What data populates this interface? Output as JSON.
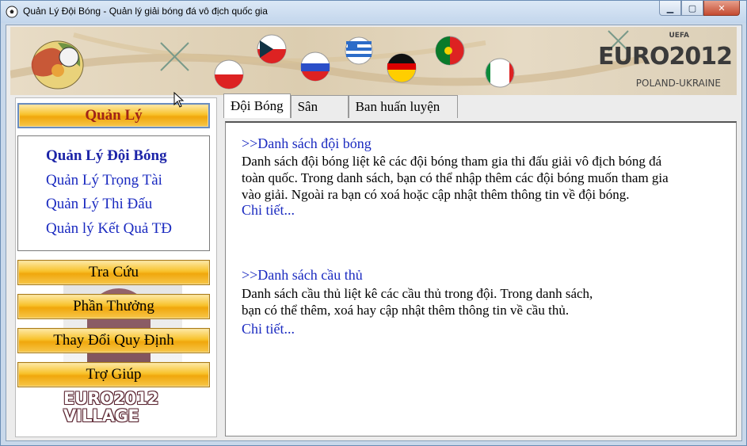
{
  "window": {
    "title": "Quản Lý Đội Bóng - Quản lý giải bóng đá vô địch quốc gia",
    "controls": [
      "minimize",
      "maximize",
      "close"
    ]
  },
  "banner": {
    "uefa": "UEFA",
    "logo_text": "EURO2012",
    "subtitle": "POLAND-UKRAINE",
    "flags": [
      "Poland",
      "Czech Republic",
      "Russia",
      "Greece",
      "Germany",
      "Portugal",
      "Italy"
    ]
  },
  "sidebar": {
    "main_button": "Quản Lý",
    "nav_items": [
      "Quản Lý Đội Bóng",
      "Quản Lý Trọng Tài",
      "Quản Lý Thi Đấu",
      "Quản lý Kết Quả TĐ"
    ],
    "buttons": [
      "Tra Cứu",
      "Phần Thưởng",
      "Thay Đổi Quy Định",
      "Trợ Giúp"
    ],
    "village_line1": "EURO2012",
    "village_line2": "VILLAGE"
  },
  "tabs": [
    "Đội Bóng",
    "Sân",
    "Ban huấn luyện"
  ],
  "content": {
    "section1": {
      "title": ">>Danh sách đội bóng",
      "lines": [
        "Danh sách đội bóng liệt kê các đội bóng tham gia thi đấu giải vô địch bóng đá",
        "toàn quốc. Trong danh sách, bạn có thể nhập thêm các đội bóng muốn tham gia",
        "vào giải. Ngoài ra bạn có xoá hoặc cập nhật thêm thông tin về đội bóng."
      ],
      "link": "Chi tiết..."
    },
    "section2": {
      "title": ">>Danh sách cầu thủ",
      "lines": [
        "Danh sách cầu thủ liệt kê các cầu thủ trong đội. Trong danh sách,",
        "bạn có thể thêm, xoá hay cập nhật thêm thông tin về cầu thủ."
      ],
      "link": "Chi tiết..."
    }
  },
  "colors": {
    "link_blue": "#1a2ac0",
    "active_red": "#a02418",
    "gold": "#f8c22b"
  }
}
